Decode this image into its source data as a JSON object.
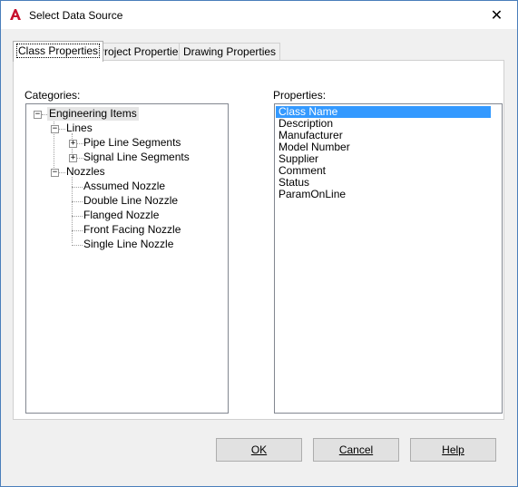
{
  "window": {
    "title": "Select Data Source",
    "app_icon": "autocad-a-icon",
    "close_glyph": "✕"
  },
  "tabs": [
    {
      "label": "Class Properties",
      "active": true
    },
    {
      "label": "Project Properties",
      "active": false
    },
    {
      "label": "Drawing Properties",
      "active": false
    }
  ],
  "categories": {
    "label": "Categories:",
    "tree": {
      "root": "Engineering Items",
      "lines": "Lines",
      "pipe_line_segments": "Pipe Line Segments",
      "signal_line_segments": "Signal Line Segments",
      "nozzles": "Nozzles",
      "assumed_nozzle": "Assumed Nozzle",
      "double_line_nozzle": "Double Line Nozzle",
      "flanged_nozzle": "Flanged Nozzle",
      "front_facing_nozzle": "Front Facing Nozzle",
      "single_line_nozzle": "Single Line Nozzle"
    },
    "expand_glyph": "+",
    "collapse_glyph": "−"
  },
  "properties": {
    "label": "Properties:",
    "items": [
      "Class Name",
      "Description",
      "Manufacturer",
      "Model Number",
      "Supplier",
      "Comment",
      "Status",
      "ParamOnLine"
    ],
    "selected": "Class Name"
  },
  "buttons": {
    "ok": "OK",
    "cancel": "Cancel",
    "help": "Help"
  }
}
